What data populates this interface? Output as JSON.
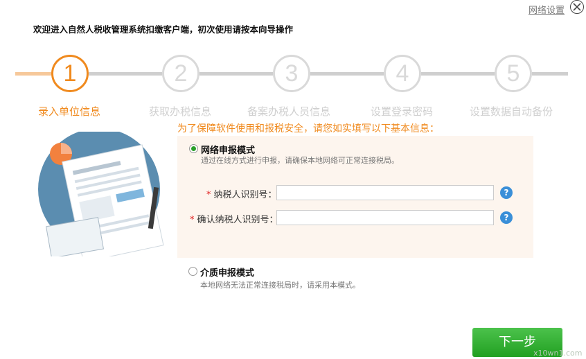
{
  "topbar": {
    "network_settings": "网络设置"
  },
  "welcome": "欢迎进入自然人税收管理系统扣缴客户端，初次使用请按本向导操作",
  "steps": [
    {
      "number": "1",
      "label": "录入单位信息",
      "active": true
    },
    {
      "number": "2",
      "label": "获取办税信息",
      "active": false
    },
    {
      "number": "3",
      "label": "备案办税人员信息",
      "active": false
    },
    {
      "number": "4",
      "label": "设置登录密码",
      "active": false
    },
    {
      "number": "5",
      "label": "设置数据自动备份",
      "active": false
    }
  ],
  "hint": "为了保障软件使用和报税安全，请您如实填写以下基本信息：",
  "network_mode": {
    "title": "网络申报模式",
    "desc": "通过在线方式进行申报，请确保本地网络可正常连接税局。",
    "selected": true
  },
  "fields": {
    "taxpayer_id_label": "纳税人识别号：",
    "taxpayer_id_value": "",
    "confirm_id_label": "确认纳税人识别号：",
    "confirm_id_value": "",
    "required_mark": "*",
    "help_glyph": "?"
  },
  "media_mode": {
    "title": "介质申报模式",
    "desc": "本地网络无法正常连接税局时，请采用本模式。",
    "selected": false
  },
  "next_button": "下一步",
  "watermark": "x10wn1.com",
  "colors": {
    "accent": "#f08a1e",
    "inactive": "#d9d9d9",
    "primary_button": "#22a022",
    "help_icon": "#3a8fd8"
  }
}
